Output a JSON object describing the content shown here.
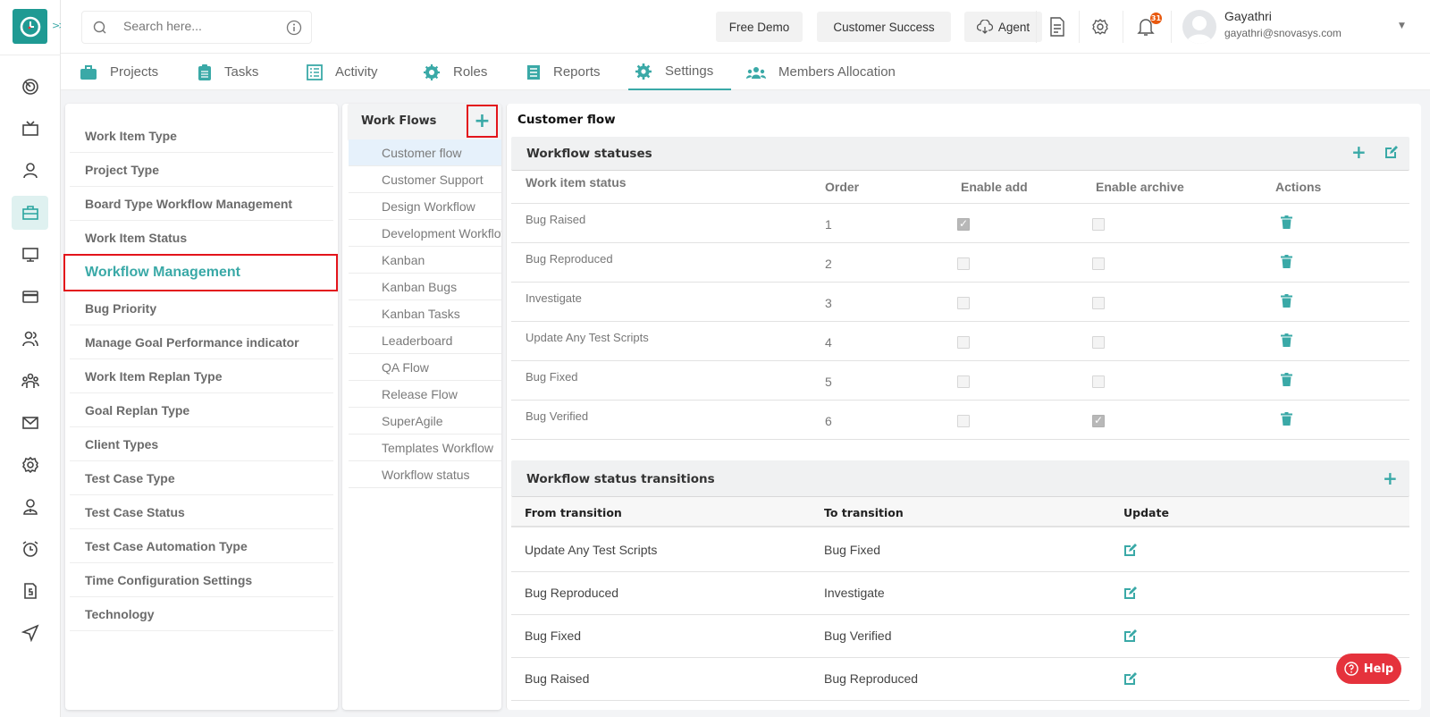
{
  "app": {
    "logo_icon": "clock-icon",
    "expand_icon": "chevrons-right-icon"
  },
  "search": {
    "placeholder": "Search here...",
    "value": "",
    "icon": "search-icon",
    "info_icon": "info-icon"
  },
  "topbar": {
    "free_demo": "Free Demo",
    "customer_success": "Customer Success",
    "agent": "Agent",
    "notification_count": "31",
    "user_name": "Gayathri",
    "user_email": "gayathri@snovasys.com"
  },
  "rail": {
    "items": [
      {
        "icon": "target-icon"
      },
      {
        "icon": "tv-icon"
      },
      {
        "icon": "user-icon"
      },
      {
        "icon": "briefcase-icon",
        "active": true
      },
      {
        "icon": "monitor-icon"
      },
      {
        "icon": "credit-card-icon"
      },
      {
        "icon": "users-icon"
      },
      {
        "icon": "team-icon"
      },
      {
        "icon": "mail-icon"
      },
      {
        "icon": "settings-icon"
      },
      {
        "icon": "user-tie-icon"
      },
      {
        "icon": "alarm-icon"
      },
      {
        "icon": "invoice-icon"
      },
      {
        "icon": "send-icon"
      }
    ]
  },
  "tabs": [
    {
      "label": "Projects",
      "icon": "briefcase-icon"
    },
    {
      "label": "Tasks",
      "icon": "clipboard-icon"
    },
    {
      "label": "Activity",
      "icon": "list-icon"
    },
    {
      "label": "Roles",
      "icon": "gear-icon"
    },
    {
      "label": "Reports",
      "icon": "report-icon"
    },
    {
      "label": "Settings",
      "icon": "cog-icon",
      "active": true
    },
    {
      "label": "Members Allocation",
      "icon": "team-icon"
    }
  ],
  "settings_menu": {
    "items": [
      "Work Item Type",
      "Project Type",
      "Board Type Workflow Management",
      "Work Item Status",
      "Workflow Management",
      "Bug Priority",
      "Manage Goal Performance indicator",
      "Work Item Replan Type",
      "Goal Replan Type",
      "Client Types",
      "Test Case Type",
      "Test Case Status",
      "Test Case Automation Type",
      "Time Configuration Settings",
      "Technology"
    ],
    "active": "Workflow Management"
  },
  "workflows": {
    "title": "Work Flows",
    "add_label": "+",
    "items": [
      "Customer flow",
      "Customer Support",
      "Design Workflow",
      "Development Workflow",
      "Kanban",
      "Kanban Bugs",
      "Kanban Tasks",
      "Leaderboard",
      "QA Flow",
      "Release Flow",
      "SuperAgile",
      "Templates Workflow",
      "Workflow status"
    ],
    "active": "Customer flow"
  },
  "main": {
    "title": "Customer flow",
    "statuses": {
      "title": "Workflow statuses",
      "columns": [
        "Work item status",
        "Order",
        "Enable add",
        "Enable archive",
        "Actions"
      ],
      "rows": [
        {
          "status": "Bug Raised",
          "order": "1",
          "enable_add": true,
          "enable_archive": false
        },
        {
          "status": "Bug Reproduced",
          "order": "2",
          "enable_add": false,
          "enable_archive": false
        },
        {
          "status": "Investigate",
          "order": "3",
          "enable_add": false,
          "enable_archive": false
        },
        {
          "status": "Update Any Test Scripts",
          "order": "4",
          "enable_add": false,
          "enable_archive": false
        },
        {
          "status": "Bug Fixed",
          "order": "5",
          "enable_add": false,
          "enable_archive": false
        },
        {
          "status": "Bug Verified",
          "order": "6",
          "enable_add": false,
          "enable_archive": true
        }
      ]
    },
    "transitions": {
      "title": "Workflow status transitions",
      "columns": [
        "From transition",
        "To transition",
        "Update"
      ],
      "rows": [
        {
          "from": "Update Any Test Scripts",
          "to": "Bug Fixed"
        },
        {
          "from": "Bug Reproduced",
          "to": "Investigate"
        },
        {
          "from": "Bug Fixed",
          "to": "Bug Verified"
        },
        {
          "from": "Bug Raised",
          "to": "Bug Reproduced"
        }
      ]
    }
  },
  "help": {
    "label": "Help"
  },
  "colors": {
    "accent": "#3aa9a7",
    "highlight_border": "#e3141b",
    "help_bg": "#e5323c",
    "badge": "#e8580d"
  }
}
